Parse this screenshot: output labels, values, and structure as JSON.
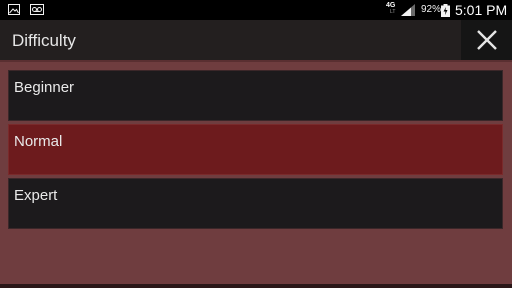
{
  "status_bar": {
    "network": "4G",
    "network_sub": "LT",
    "battery_percent": "92%",
    "time": "5:01 PM",
    "icons": [
      "image-icon",
      "voicemail-icon",
      "signal-icon",
      "battery-charging-icon"
    ]
  },
  "dialog": {
    "title": "Difficulty",
    "close_icon": "close-icon",
    "options": [
      {
        "label": "Beginner",
        "selected": false
      },
      {
        "label": "Normal",
        "selected": true
      },
      {
        "label": "Expert",
        "selected": false
      }
    ]
  },
  "colors": {
    "dialog_background": "#6f3d3f",
    "selected_option": "#6d1b1d",
    "option_background": "#1c1a1c",
    "title_bar": "#231f1f"
  }
}
